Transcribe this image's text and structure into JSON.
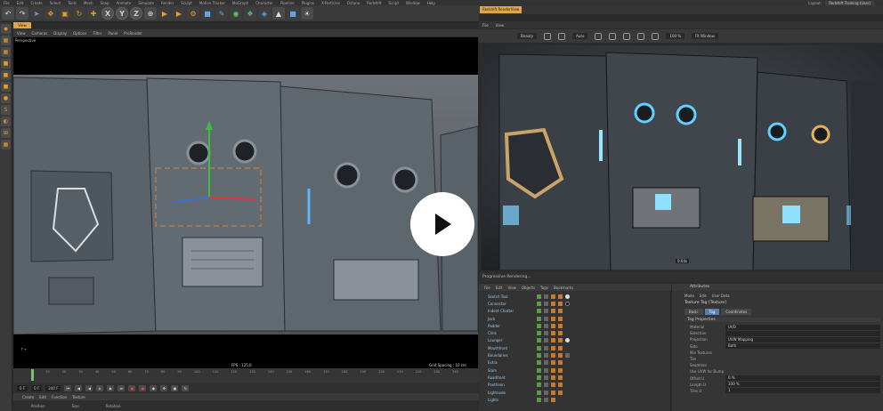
{
  "menubar": {
    "items": [
      "File",
      "Edit",
      "Create",
      "Select",
      "Tools",
      "Mesh",
      "Snap",
      "Animate",
      "Simulate",
      "Render",
      "Sculpt",
      "Motion Tracker",
      "MoGraph",
      "Character",
      "Pipeline",
      "Plugins",
      "X-Particles",
      "Octane",
      "Redshift",
      "Script",
      "Window",
      "Help"
    ],
    "layout_label": "Layout:",
    "layout_value": "Redshift Training (User)"
  },
  "toolbar": {
    "axis_x": "X",
    "axis_y": "Y",
    "axis_z": "Z"
  },
  "viewport": {
    "tab": "View",
    "menu": [
      "View",
      "Cameras",
      "Display",
      "Options",
      "Filter",
      "Panel",
      "ProRender"
    ],
    "label": "Perspective",
    "fps": "FPS : 125.0",
    "grid_spacing": "Grid Spacing : 10 cm"
  },
  "timeline": {
    "ticks": [
      "0",
      "10",
      "20",
      "30",
      "40",
      "50",
      "60",
      "70",
      "80",
      "90",
      "100",
      "110",
      "120",
      "130",
      "140",
      "150",
      "160",
      "170",
      "180",
      "190",
      "200",
      "210",
      "220",
      "230",
      "240"
    ],
    "current_frame": "0 F",
    "start_field": "0 F",
    "end_field": "240 F"
  },
  "coords": {
    "tabs": [
      "Create",
      "Edit",
      "Function",
      "Texture"
    ],
    "headers": [
      "Position",
      "Size",
      "Rotation"
    ]
  },
  "renderview": {
    "tab": "Redshift RenderView",
    "menu": [
      "File",
      "View"
    ],
    "beauty": "Beauty",
    "auto": "Auto",
    "zoom": "100 %",
    "fit": "Fit Window",
    "timecode": "0:04s",
    "status": "Progressive Rendering..."
  },
  "objects": {
    "menu": [
      "File",
      "Edit",
      "View",
      "Objects",
      "Tags",
      "Bookmarks"
    ],
    "rows": [
      {
        "name": "Sketch Tool"
      },
      {
        "name": "Connector"
      },
      {
        "name": "Indent Chatter"
      },
      {
        "name": "Jack"
      },
      {
        "name": "Padder"
      },
      {
        "name": "Clink"
      },
      {
        "name": "Lounger"
      },
      {
        "name": "Mouthfront"
      },
      {
        "name": "Boundaries"
      },
      {
        "name": "Extra"
      },
      {
        "name": "Slam"
      },
      {
        "name": "Roadfront"
      },
      {
        "name": "Pantheon"
      },
      {
        "name": "Lightnode"
      },
      {
        "name": "Lights"
      }
    ]
  },
  "attributes": {
    "title": "Attributes",
    "menu": [
      "Mode",
      "Edit",
      "User Data"
    ],
    "tag_title": "Texture Tag [Texture]",
    "tabs": [
      {
        "label": "Basic",
        "on": false
      },
      {
        "label": "Tag",
        "on": true
      },
      {
        "label": "Coordinates",
        "on": false
      }
    ],
    "section": "Tag Properties",
    "rows": [
      {
        "label": "Material",
        "value": "UVD"
      },
      {
        "label": "Selection",
        "value": ""
      },
      {
        "label": "Projection",
        "value": "UVW Mapping"
      },
      {
        "label": "Side",
        "value": "Both"
      },
      {
        "label": "Mix Textures",
        "value": ""
      },
      {
        "label": "Tile",
        "value": ""
      },
      {
        "label": "Seamless",
        "value": ""
      },
      {
        "label": "Use UVW for Bump",
        "value": ""
      },
      {
        "label": "Offset U",
        "value": "0 %"
      },
      {
        "label": "Length U",
        "value": "100 %"
      },
      {
        "label": "Tiles U",
        "value": "1"
      }
    ]
  },
  "colors": {
    "accent": "#e0a54a",
    "selected_tab": "#5a80b0",
    "viewport_bg": "#000000"
  }
}
